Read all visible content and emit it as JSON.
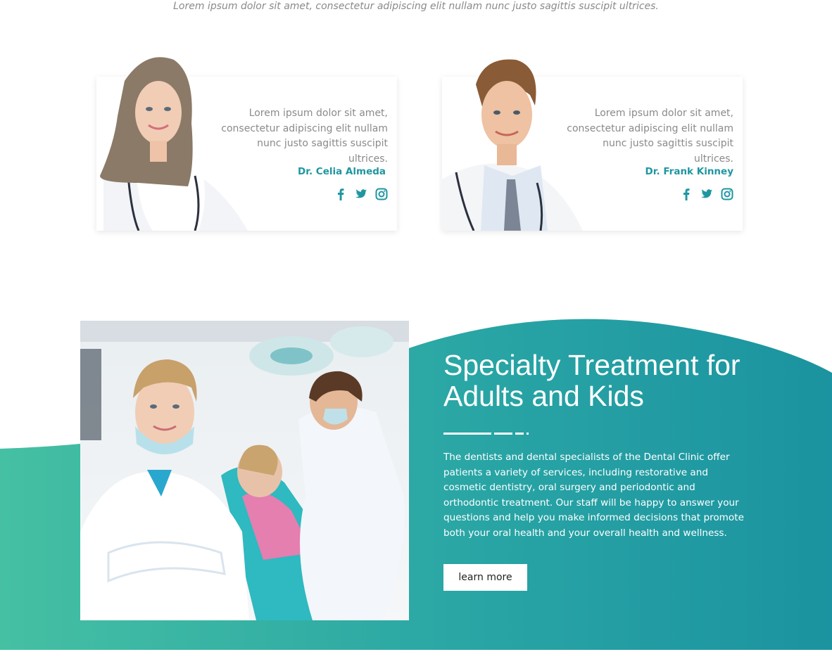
{
  "intro": {
    "text": "Lorem ipsum dolor sit amet, consectetur adipiscing elit nullam nunc justo sagittis suscipit ultrices."
  },
  "doctors": [
    {
      "name": "Dr. Celia Almeda",
      "bio": "Lorem ipsum dolor sit amet, consectetur adipiscing elit nullam nunc justo sagittis suscipit ultrices.",
      "socials": [
        "facebook-icon",
        "twitter-icon",
        "instagram-icon"
      ]
    },
    {
      "name": "Dr. Frank Kinney",
      "bio": "Lorem ipsum dolor sit amet, consectetur adipiscing elit nullam nunc justo sagittis suscipit ultrices.",
      "socials": [
        "facebook-icon",
        "twitter-icon",
        "instagram-icon"
      ]
    }
  ],
  "specialty": {
    "title": "Specialty Treatment for Adults and Kids",
    "body": "The dentists and dental specialists of the Dental Clinic offer patients a variety of services, including restorative and cosmetic dentistry, oral surgery and periodontic and orthodontic treatment. Our staff will be happy to answer your questions and help you make informed decisions that promote both your oral health and your overall health and wellness.",
    "button_label": "learn more"
  },
  "colors": {
    "accent": "#1f96a1",
    "gradient_start": "#45c0a3",
    "gradient_end": "#1b93a0",
    "muted_text": "#8a8a8a"
  }
}
